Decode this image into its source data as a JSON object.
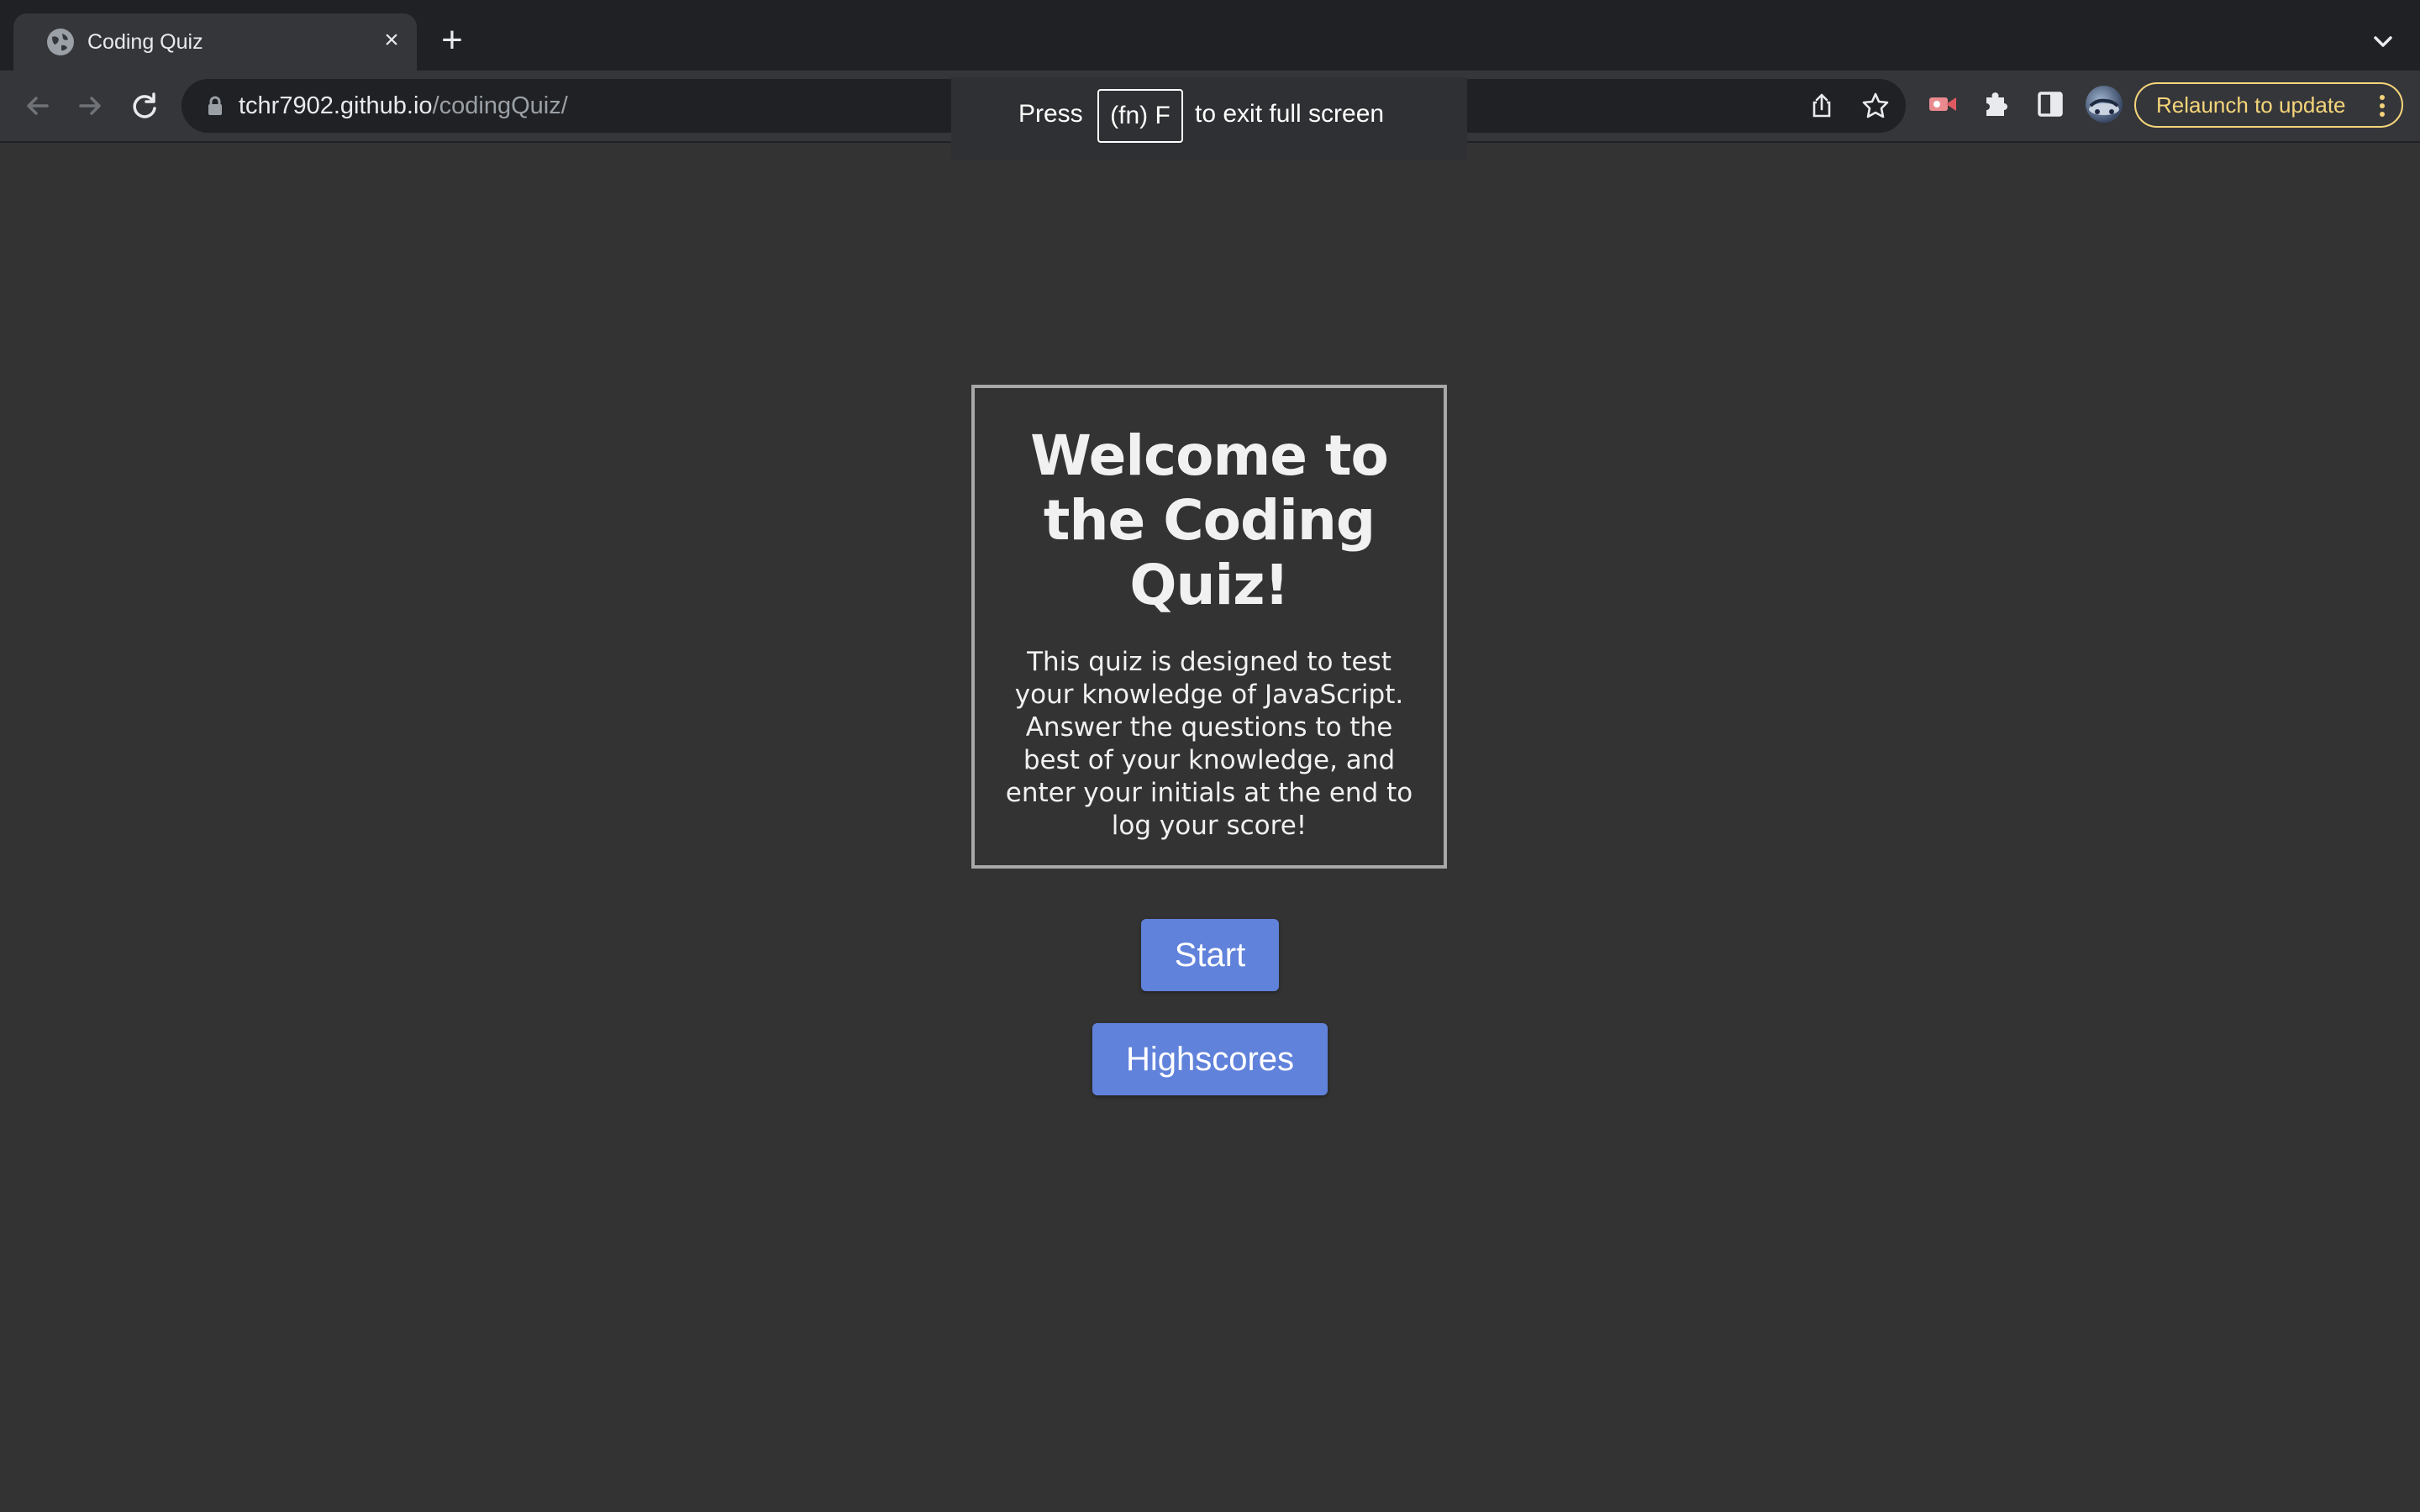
{
  "browser": {
    "tab": {
      "title": "Coding Quiz",
      "close_glyph": "×",
      "favicon": "globe-icon"
    },
    "new_tab_glyph": "+",
    "url": {
      "host": "tchr7902.github.io",
      "path": "/codingQuiz/"
    },
    "relaunch_label": "Relaunch to update",
    "accent_color": "#f5d57a"
  },
  "fullscreen_hint": {
    "press": "Press",
    "key": "(fn) F",
    "suffix": "to exit full screen"
  },
  "quiz": {
    "heading": "Welcome to the Coding Quiz!",
    "description": "This quiz is designed to test your knowledge of JavaScript. Answer the questions to the best of your knowledge, and enter your initials at the end to log your score!",
    "start_label": "Start",
    "highscores_label": "Highscores",
    "button_color": "#6082db"
  }
}
